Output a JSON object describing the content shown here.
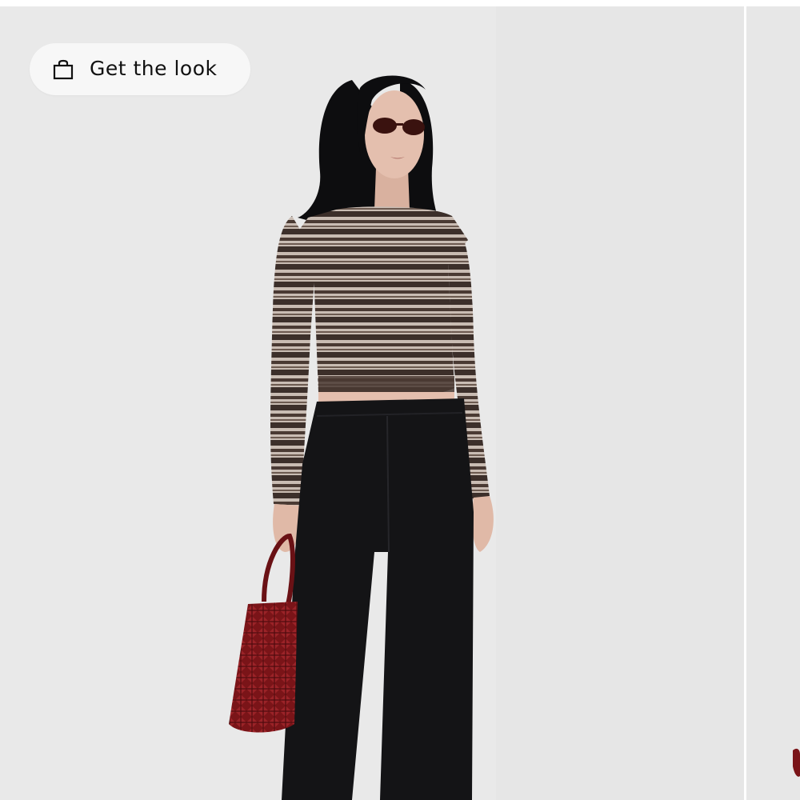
{
  "look_button": {
    "label": "Get the look",
    "icon": "shopping-bag-icon"
  },
  "colors": {
    "background": "#e9e9e9",
    "button_bg": "#f7f7f7",
    "top": "#3c2f2a",
    "top_stripe": "#c9bcb3",
    "trousers": "#141416",
    "bag": "#7a1418",
    "hair": "#0d0d0f",
    "skin": "#e4bfae"
  }
}
